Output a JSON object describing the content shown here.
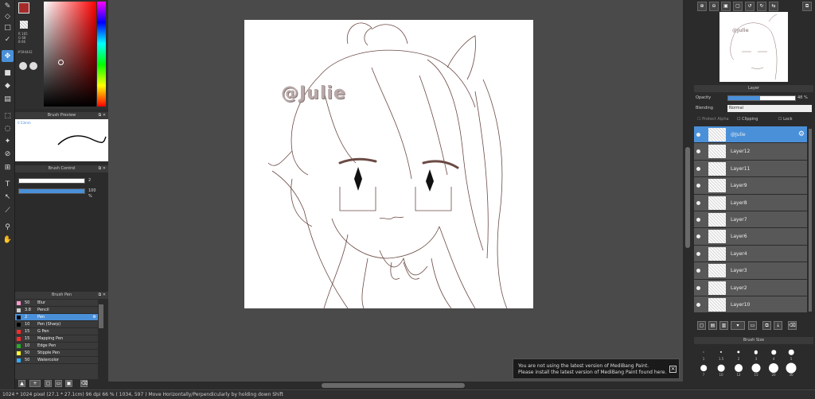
{
  "colors": {
    "foreground": "#a52a2a",
    "background": "#ffffff",
    "accent": "#4a90d9"
  },
  "color_panel": {
    "r": "R 165",
    "g": "G 68",
    "b": "B 66",
    "hex": "#594442"
  },
  "brush_preview": {
    "title": "Brush Preview",
    "size": "0.53mm"
  },
  "brush_control": {
    "title": "Brush Control",
    "size_value": "2",
    "opacity_value": "100 %",
    "opacity_level": 100
  },
  "brush_panel": {
    "title": "Brush Pen",
    "items": [
      {
        "num": "50",
        "label": "Blur",
        "color": "#ff99cc"
      },
      {
        "num": "3.8",
        "label": "Pencil",
        "color": "#d0d0d0"
      },
      {
        "num": "2",
        "label": "Pen",
        "color": "#000000",
        "selected": true
      },
      {
        "num": "10",
        "label": "Pen (Sharp)",
        "color": "#000000"
      },
      {
        "num": "15",
        "label": "G Pen",
        "color": "#ff2a2a"
      },
      {
        "num": "15",
        "label": "Mapping Pen",
        "color": "#ff2a2a"
      },
      {
        "num": "10",
        "label": "Edge Pen",
        "color": "#2aaa2a"
      },
      {
        "num": "50",
        "label": "Stipple Pen",
        "color": "#ffff33"
      },
      {
        "num": "50",
        "label": "Watercolor",
        "color": "#33aaff"
      }
    ]
  },
  "canvas": {
    "watermark": "@Julie"
  },
  "toast": {
    "line1": "You are not using the latest version of MediBang Paint.",
    "line2": "Please install the latest version of MediBang Paint found here.",
    "close": "×"
  },
  "layer_panel": {
    "title": "Layer",
    "opacity_label": "Opacity",
    "opacity_value": "48 %",
    "opacity_level": 48,
    "blending_label": "Blending",
    "blending_value": "Normal",
    "protect_alpha": "Protect Alpha",
    "clipping": "Clipping",
    "lock": "Lock",
    "layers": [
      {
        "name": "@Julie",
        "selected": true
      },
      {
        "name": "Layer12"
      },
      {
        "name": "Layer11"
      },
      {
        "name": "Layer9"
      },
      {
        "name": "Layer8"
      },
      {
        "name": "Layer7"
      },
      {
        "name": "Layer6"
      },
      {
        "name": "Layer4"
      },
      {
        "name": "Layer3"
      },
      {
        "name": "Layer2"
      },
      {
        "name": "Layer10"
      }
    ]
  },
  "brush_size_panel": {
    "title": "Brush Size",
    "sizes": [
      "1",
      "1.5",
      "2",
      "3",
      "4",
      "5",
      "7",
      "10",
      "12",
      "15",
      "20",
      "30"
    ]
  },
  "statusbar": {
    "text": "1024 * 1024 pixel   (27.1 * 27.1cm)   96 dpi   66 %   ( 1034, 597 )   Move Horizontally/Perpendicularly by holding down Shift"
  }
}
